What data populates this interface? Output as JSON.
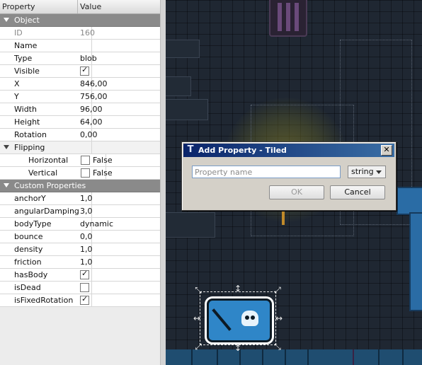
{
  "panel": {
    "header": {
      "property": "Property",
      "value": "Value"
    },
    "object_group": "Object",
    "object": {
      "id": {
        "label": "ID",
        "value": "160"
      },
      "name": {
        "label": "Name",
        "value": ""
      },
      "type": {
        "label": "Type",
        "value": "blob"
      },
      "visible": {
        "label": "Visible",
        "checked": true
      },
      "x": {
        "label": "X",
        "value": "846,00"
      },
      "y": {
        "label": "Y",
        "value": "756,00"
      },
      "width": {
        "label": "Width",
        "value": "96,00"
      },
      "height": {
        "label": "Height",
        "value": "64,00"
      },
      "rotation": {
        "label": "Rotation",
        "value": "0,00"
      },
      "flipping": {
        "label": "Flipping"
      },
      "horizontal": {
        "label": "Horizontal",
        "value": "False",
        "checked": false
      },
      "vertical": {
        "label": "Vertical",
        "value": "False",
        "checked": false
      }
    },
    "custom_group": "Custom Properties",
    "custom": {
      "anchorY": {
        "label": "anchorY",
        "value": "1,0"
      },
      "angularDamping": {
        "label": "angularDamping",
        "value": "3,0"
      },
      "bodyType": {
        "label": "bodyType",
        "value": "dynamic"
      },
      "bounce": {
        "label": "bounce",
        "value": "0,0"
      },
      "density": {
        "label": "density",
        "value": "1,0"
      },
      "friction": {
        "label": "friction",
        "value": "1,0"
      },
      "hasBody": {
        "label": "hasBody",
        "checked": true
      },
      "isDead": {
        "label": "isDead",
        "checked": false
      },
      "isFixedRotation": {
        "label": "isFixedRotation",
        "checked": true
      }
    }
  },
  "dialog": {
    "title": "Add Property - Tiled",
    "close_label": "✕",
    "name_placeholder": "Property name",
    "name_value": "",
    "type_selected": "string",
    "ok_label": "OK",
    "cancel_label": "Cancel"
  },
  "icons": {
    "expand": "triangle-down-icon",
    "checkbox": "checkmark-icon",
    "app": "tiled-icon",
    "close": "close-icon",
    "dropdown": "chevron-down-icon",
    "resize": "resize-handle-icon"
  }
}
